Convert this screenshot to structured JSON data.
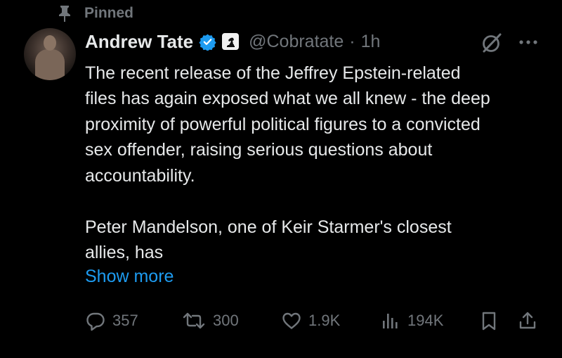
{
  "pinned": {
    "label": "Pinned",
    "icon": "pin-icon"
  },
  "author": {
    "name": "Andrew Tate",
    "handle": "@Cobratate",
    "separator": "·",
    "time": "1h",
    "verified_color": "#1d9bf0"
  },
  "tweet": {
    "paragraph_1": "The recent release of the Jeffrey Epstein-related\nfiles has again exposed what we all knew - the deep\nproximity of powerful political figures to a convicted\nsex offender, raising serious questions about\naccountability.",
    "paragraph_2": "Peter Mandelson, one of Keir Starmer's closest\nallies, has",
    "show_more": "Show more"
  },
  "actions": {
    "replies": "357",
    "reposts": "300",
    "likes": "1.9K",
    "views": "194K"
  },
  "colors": {
    "background": "#000000",
    "text": "#e7e9ea",
    "muted": "#71767b",
    "link": "#1d9bf0"
  }
}
